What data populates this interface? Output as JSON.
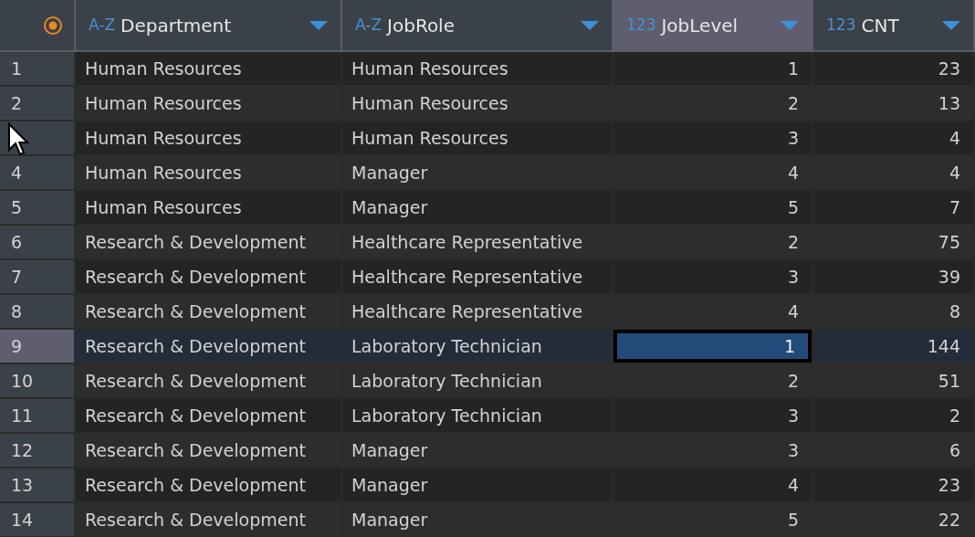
{
  "columns": [
    {
      "kind": "text",
      "type_label": "A-Z",
      "name": "Department",
      "selected": false
    },
    {
      "kind": "text",
      "type_label": "A-Z",
      "name": "JobRole",
      "selected": false
    },
    {
      "kind": "number",
      "type_label": "123",
      "name": "JobLevel",
      "selected": true
    },
    {
      "kind": "number",
      "type_label": "123",
      "name": "CNT",
      "selected": false
    }
  ],
  "rows": [
    {
      "row_number": "1",
      "selected": false,
      "cells": [
        "Human Resources",
        "Human Resources",
        "1",
        "23"
      ]
    },
    {
      "row_number": "2",
      "selected": false,
      "cells": [
        "Human Resources",
        "Human Resources",
        "2",
        "13"
      ]
    },
    {
      "selected": false,
      "cells": [
        "Human Resources",
        "Human Resources",
        "3",
        "4"
      ]
    },
    {
      "row_number": "4",
      "selected": false,
      "cells": [
        "Human Resources",
        "Manager",
        "4",
        "4"
      ]
    },
    {
      "row_number": "5",
      "selected": false,
      "cells": [
        "Human Resources",
        "Manager",
        "5",
        "7"
      ]
    },
    {
      "row_number": "6",
      "selected": false,
      "cells": [
        "Research & Development",
        "Healthcare Representative",
        "2",
        "75"
      ]
    },
    {
      "row_number": "7",
      "selected": false,
      "cells": [
        "Research & Development",
        "Healthcare Representative",
        "3",
        "39"
      ]
    },
    {
      "row_number": "8",
      "selected": false,
      "cells": [
        "Research & Development",
        "Healthcare Representative",
        "4",
        "8"
      ]
    },
    {
      "row_number": "9",
      "selected": true,
      "cells": [
        "Research & Development",
        "Laboratory Technician",
        "1",
        "144"
      ]
    },
    {
      "row_number": "10",
      "selected": false,
      "cells": [
        "Research & Development",
        "Laboratory Technician",
        "2",
        "51"
      ]
    },
    {
      "row_number": "11",
      "selected": false,
      "cells": [
        "Research & Development",
        "Laboratory Technician",
        "3",
        "2"
      ]
    },
    {
      "row_number": "12",
      "selected": false,
      "cells": [
        "Research & Development",
        "Manager",
        "3",
        "6"
      ]
    },
    {
      "row_number": "13",
      "selected": false,
      "cells": [
        "Research & Development",
        "Manager",
        "4",
        "23"
      ]
    },
    {
      "row_number": "14",
      "selected": false,
      "cells": [
        "Research & Development",
        "Manager",
        "5",
        "22"
      ]
    }
  ]
}
